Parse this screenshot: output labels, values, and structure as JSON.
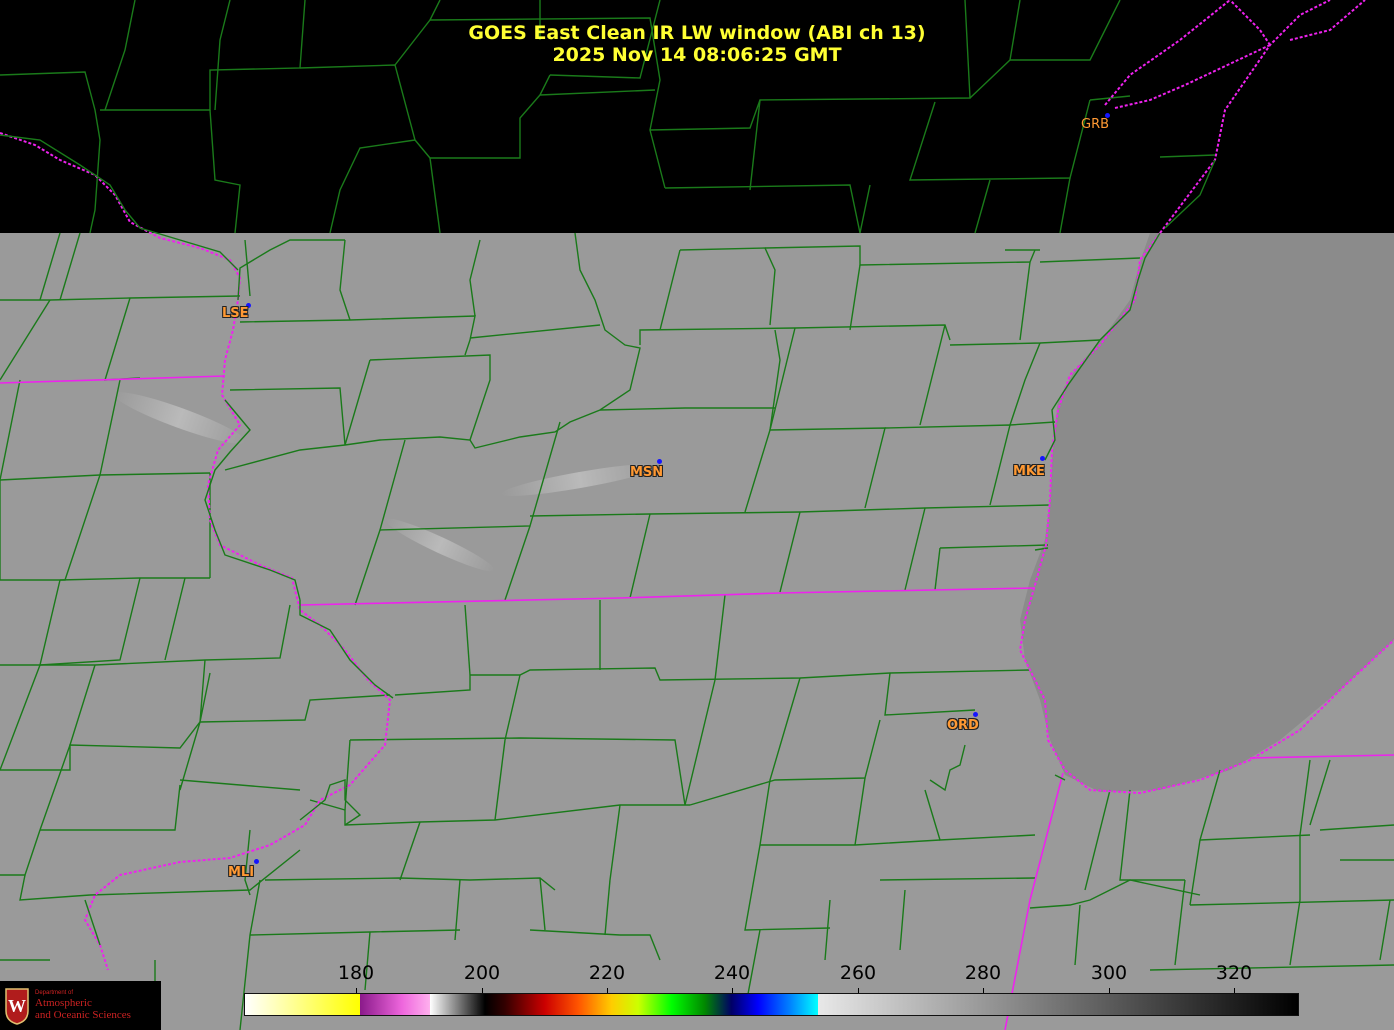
{
  "title": {
    "line1": "GOES East Clean IR LW window (ABI ch 13)",
    "line2": "2025 Nov 14  08:06:25 GMT"
  },
  "stations": [
    {
      "id": "lse",
      "label": "LSE"
    },
    {
      "id": "msn",
      "label": "MSN"
    },
    {
      "id": "mke",
      "label": "MKE"
    },
    {
      "id": "ord",
      "label": "ORD"
    },
    {
      "id": "mli",
      "label": "MLI"
    },
    {
      "id": "grb",
      "label": "GRB"
    }
  ],
  "colorbar": {
    "ticks": [
      "180",
      "200",
      "220",
      "240",
      "260",
      "280",
      "300",
      "320"
    ]
  },
  "colors": {
    "county_lines": "#1a7a1a",
    "state_borders": "#ee22ee",
    "land_ir": "#9a9a9a",
    "lake_ir": "#8b8b8b",
    "no_data": "#000000",
    "title": "#ffff33",
    "station_label": "#ff9933",
    "station_dot": "#1515ff"
  },
  "logo": {
    "department": "Department of",
    "name_line1": "Atmospheric",
    "name_line2": "and Oceanic Sciences"
  }
}
